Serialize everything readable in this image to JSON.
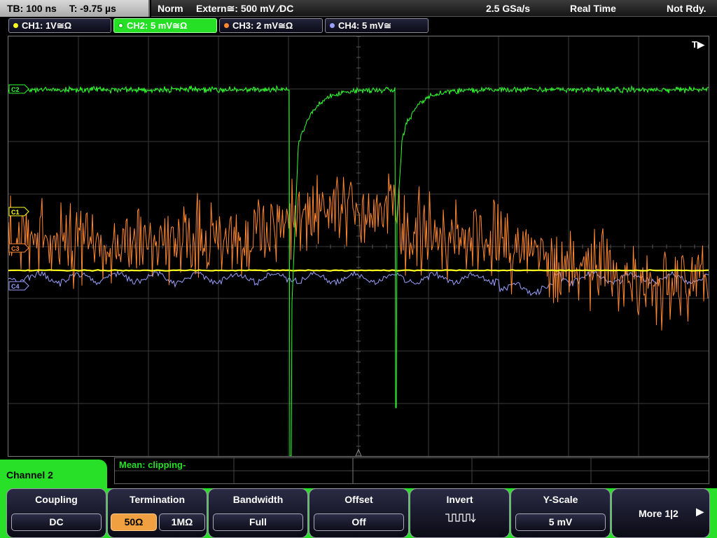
{
  "status": {
    "timebase": "TB: 100 ns",
    "time_offset": "T: -9.75 µs",
    "trigger_mode": "Norm",
    "trigger_source": "Extern≅: 500 mV ⁄DC",
    "sample_rate": "2.5 GSa/s",
    "acquisition": "Real Time",
    "run_state": "Not Rdy."
  },
  "channel_tabs": [
    {
      "label": "CH1: 1V≅Ω",
      "color": "#ffff20"
    },
    {
      "label": "CH2: 5 mV≅Ω",
      "color": "#30ff30"
    },
    {
      "label": "CH3: 2 mV≅Ω",
      "color": "#ff8830"
    },
    {
      "label": "CH4: 5 mV≅",
      "color": "#9aa0ff"
    }
  ],
  "markers": {
    "c1": "C1",
    "c2": "C2",
    "c3": "C3",
    "c4": "C4",
    "trigger_position": "T▶"
  },
  "measurement": {
    "label": "Mean: clipping-"
  },
  "panel": {
    "title": "Channel 2"
  },
  "softkeys": {
    "coupling": {
      "title": "Coupling",
      "value": "DC"
    },
    "termination": {
      "title": "Termination",
      "opt1": "50Ω",
      "opt2": "1MΩ"
    },
    "bandwidth": {
      "title": "Bandwidth",
      "value": "Full"
    },
    "offset": {
      "title": "Offset",
      "value": "Off"
    },
    "invert": {
      "title": "Invert",
      "icon": "invert-waveform-icon"
    },
    "yscale": {
      "title": "Y-Scale",
      "value": "5 mV"
    },
    "more": {
      "label": "More 1|2",
      "icon": "arrow-right-icon"
    }
  },
  "colors": {
    "ch1": "#ffff20",
    "ch2": "#30ff30",
    "ch3": "#ff8830",
    "ch4": "#9aa0ff",
    "panel_accent": "#27e027"
  }
}
